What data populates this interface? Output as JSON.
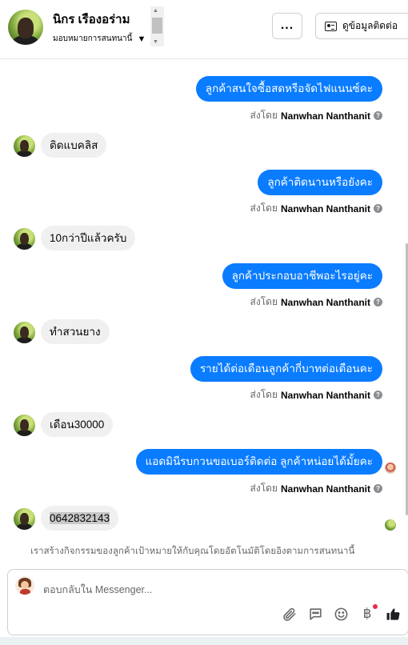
{
  "header": {
    "contact_name": "นิกร เรืองอร่าม",
    "assign_label": "มอบหมายการสนทนานี้",
    "more_label": "...",
    "info_button_label": "ดูข้อมูลติดต่อ"
  },
  "messages": [
    {
      "dir": "out",
      "text": "ลูกค้าสนใจซื้อสดหรือจัดไฟแนนซ์คะ",
      "sender_prefix": "ส่งโดย",
      "sender_name": "Nanwhan Nanthanit"
    },
    {
      "dir": "in",
      "text": "ติดแบคลิส"
    },
    {
      "dir": "out",
      "text": "ลูกค้าติดนานหรือยังคะ",
      "sender_prefix": "ส่งโดย",
      "sender_name": "Nanwhan Nanthanit"
    },
    {
      "dir": "in",
      "text": "10กว่าปีแล้วครับ"
    },
    {
      "dir": "out",
      "text": "ลูกค้าประกอบอาชีพอะไรอยู่คะ",
      "sender_prefix": "ส่งโดย",
      "sender_name": "Nanwhan Nanthanit"
    },
    {
      "dir": "in",
      "text": "ทำสวนยาง"
    },
    {
      "dir": "out",
      "text": "รายได้ต่อเดือนลูกค้ากี่บาทต่อเดือนคะ",
      "sender_prefix": "ส่งโดย",
      "sender_name": "Nanwhan Nanthanit"
    },
    {
      "dir": "in",
      "text": "เดือน30000"
    },
    {
      "dir": "out",
      "text": "แอดมินีรบกวนขอเบอร์ติดต่อ ลูกค้าหน่อยได้มั้ยคะ",
      "sender_prefix": "ส่งโดย",
      "sender_name": "Nanwhan Nanthanit"
    },
    {
      "dir": "in",
      "text": "0642832143"
    }
  ],
  "footnote": "เราสร้างกิจกรรมของลูกค้าเป้าหมายให้กับคุณโดยอัตโนมัติโดยอิงตามการสนทนานี้",
  "composer": {
    "placeholder": "ตอบกลับใน Messenger..."
  },
  "icons": {
    "attach": "paperclip-icon",
    "saved_replies": "chat-bubble-icon",
    "emoji": "smiley-icon",
    "payment": "baht-icon",
    "like": "thumbs-up-icon"
  },
  "colors": {
    "outgoing_bubble": "#0a7cff",
    "incoming_bubble": "#f0f0f0",
    "notification_dot": "#f02849"
  }
}
